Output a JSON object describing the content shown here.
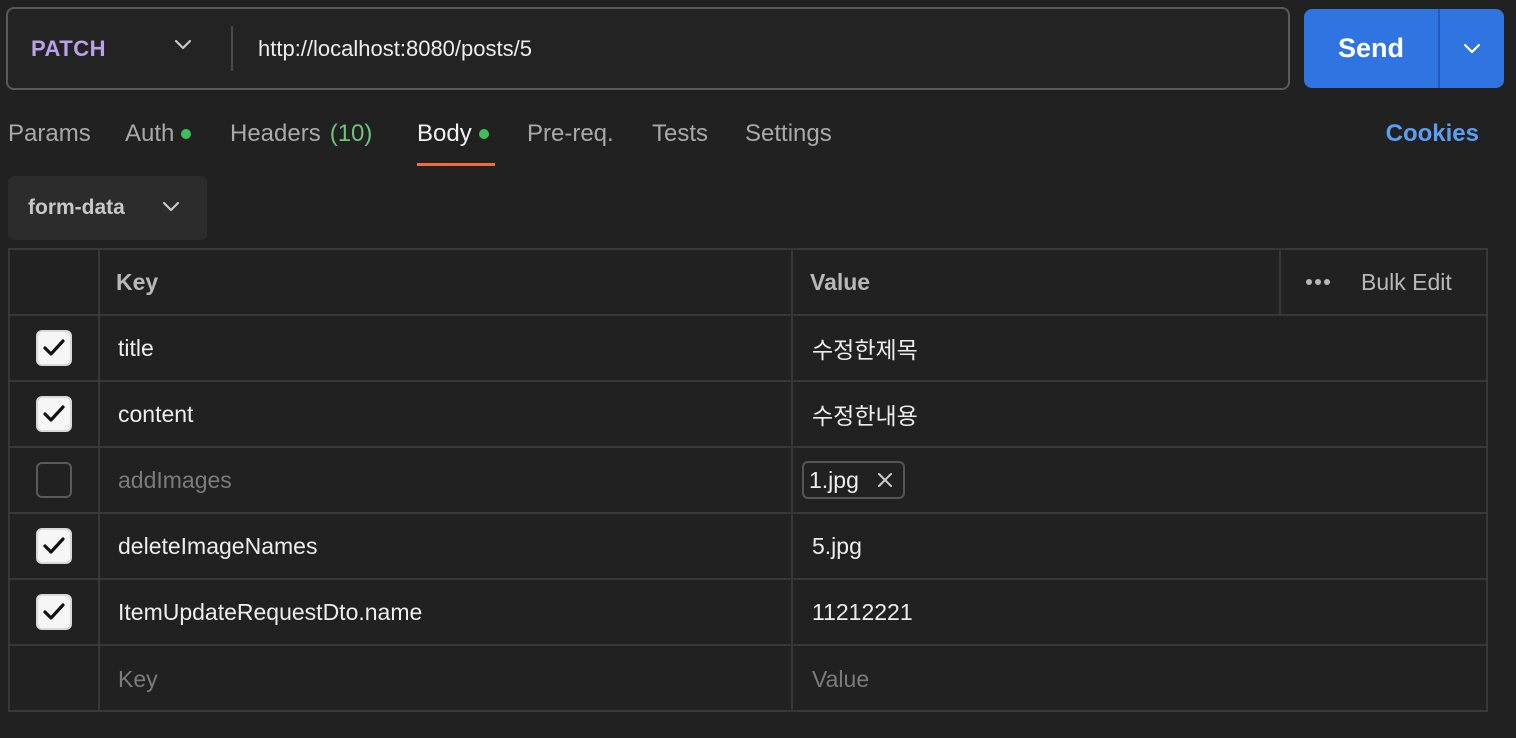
{
  "request": {
    "method": "PATCH",
    "url": "http://localhost:8080/posts/5",
    "send_label": "Send"
  },
  "tabs": {
    "params": "Params",
    "auth": "Auth",
    "headers": "Headers",
    "headers_count": "(10)",
    "body": "Body",
    "prereq": "Pre-req.",
    "tests": "Tests",
    "settings": "Settings",
    "cookies": "Cookies",
    "active": "Body"
  },
  "body_type": "form-data",
  "table": {
    "header_key": "Key",
    "header_value": "Value",
    "bulk_edit": "Bulk Edit",
    "rows": [
      {
        "checked": true,
        "key": "title",
        "value": "수정한제목"
      },
      {
        "checked": true,
        "key": "content",
        "value": "수정한내용"
      },
      {
        "checked": false,
        "key": "addImages",
        "file": "1.jpg"
      },
      {
        "checked": true,
        "key": "deleteImageNames",
        "value": "5.jpg"
      },
      {
        "checked": true,
        "key": "ItemUpdateRequestDto.name",
        "value": "11212221"
      }
    ],
    "placeholder_key": "Key",
    "placeholder_value": "Value"
  },
  "colors": {
    "background": "#212121",
    "method": "#b7a3e8",
    "send": "#2f74e0",
    "active_tab_underline": "#ef6c3a",
    "status_dot": "#3fbf5a",
    "cookies_link": "#5a9ff0"
  }
}
